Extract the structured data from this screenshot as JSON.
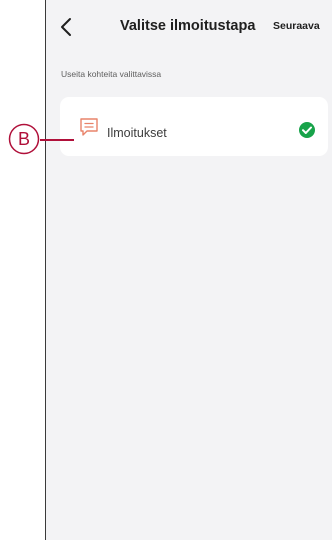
{
  "header": {
    "title": "Valitse ilmoitustapa",
    "next_label": "Seuraava"
  },
  "subtitle": "Useita kohteita valittavissa",
  "options": [
    {
      "label": "Ilmoitukset",
      "icon": "message-icon",
      "selected": true
    }
  ],
  "callout": {
    "letter": "B"
  },
  "colors": {
    "accent_green": "#18a34a",
    "icon_orange": "#e8836a",
    "callout_red": "#b0103a",
    "background": "#f3f3f5"
  }
}
